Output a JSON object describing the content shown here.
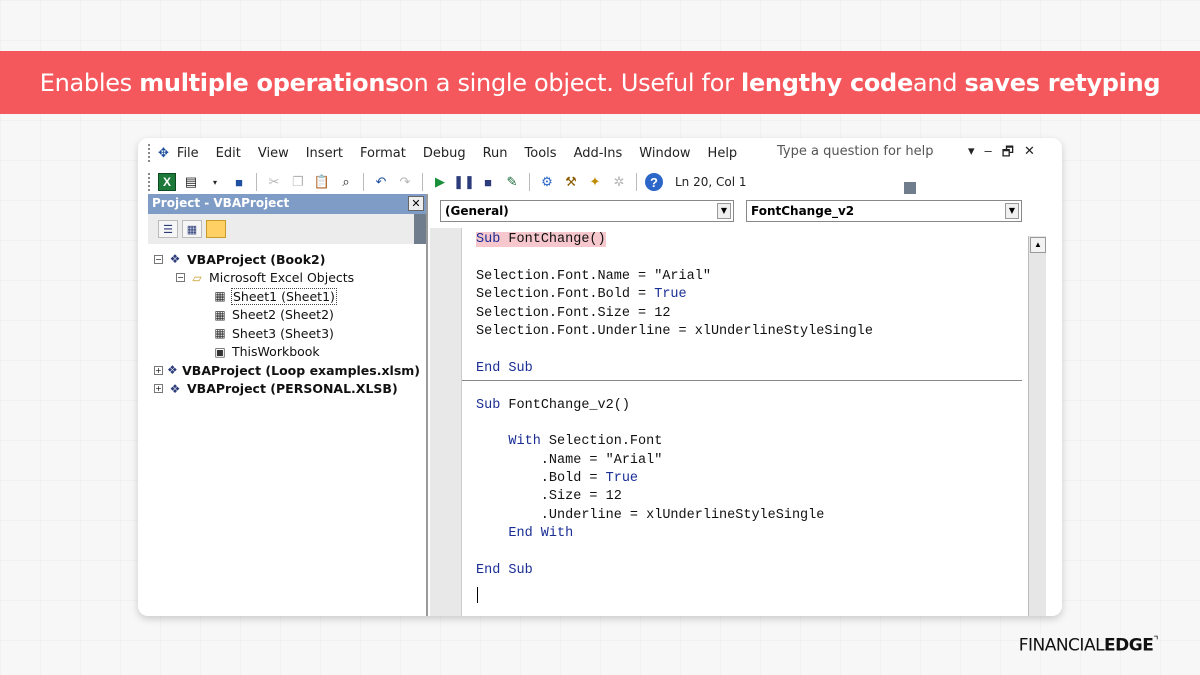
{
  "banner": {
    "p1": "Enables ",
    "b1": "multiple operations",
    "p2": " on a single object. Useful for ",
    "b2": "lengthy code",
    "p3": " and ",
    "b3": "saves retyping"
  },
  "menu": {
    "items": [
      "File",
      "Edit",
      "View",
      "Insert",
      "Format",
      "Debug",
      "Run",
      "Tools",
      "Add-Ins",
      "Window",
      "Help"
    ],
    "help_placeholder": "Type a question for help",
    "window_controls": [
      "▾",
      "–",
      "🗗",
      "✕"
    ]
  },
  "toolbar": {
    "position": "Ln 20, Col 1"
  },
  "project_panel": {
    "title": "Project - VBAProject",
    "close": "✕",
    "tree": [
      {
        "label": "VBAProject (Book2)",
        "expander": "−",
        "bold": true,
        "level": 0
      },
      {
        "label": "Microsoft Excel Objects",
        "expander": "−",
        "bold": false,
        "level": 1
      },
      {
        "label": "Sheet1 (Sheet1)",
        "bold": false,
        "level": 2,
        "selected": true
      },
      {
        "label": "Sheet2 (Sheet2)",
        "bold": false,
        "level": 2
      },
      {
        "label": "Sheet3 (Sheet3)",
        "bold": false,
        "level": 2
      },
      {
        "label": "ThisWorkbook",
        "bold": false,
        "level": 2
      },
      {
        "label": "VBAProject (Loop examples.xlsm)",
        "expander": "+",
        "bold": true,
        "level": 0
      },
      {
        "label": "VBAProject (PERSONAL.XLSB)",
        "expander": "+",
        "bold": true,
        "level": 0
      }
    ]
  },
  "code_window": {
    "object_dropdown": "(General)",
    "procedure_dropdown": "FontChange_v2",
    "lines": [
      {
        "kw": "Sub",
        "rest": " FontChange()",
        "highlight": true
      },
      {
        "text": ""
      },
      {
        "text": "Selection.Font.Name = \"Arial\""
      },
      {
        "pre": "Selection.Font.Bold = ",
        "kw": "True"
      },
      {
        "text": "Selection.Font.Size = 12"
      },
      {
        "text": "Selection.Font.Underline = xlUnderlineStyleSingle"
      },
      {
        "text": ""
      },
      {
        "kw": "End Sub"
      },
      {
        "text": ""
      },
      {
        "kw": "Sub",
        "rest": " FontChange_v2()"
      },
      {
        "text": ""
      },
      {
        "pre": "    ",
        "kw": "With",
        "rest": " Selection.Font"
      },
      {
        "text": "        .Name = \"Arial\""
      },
      {
        "pre": "        .Bold = ",
        "kw": "True"
      },
      {
        "text": "        .Size = 12"
      },
      {
        "text": "        .Underline = xlUnderlineStyleSingle"
      },
      {
        "pre": "    ",
        "kw": "End With"
      },
      {
        "text": ""
      },
      {
        "kw": "End Sub"
      }
    ]
  },
  "logo": {
    "part1": "FINANCIAL",
    "part2": "EDGE"
  }
}
